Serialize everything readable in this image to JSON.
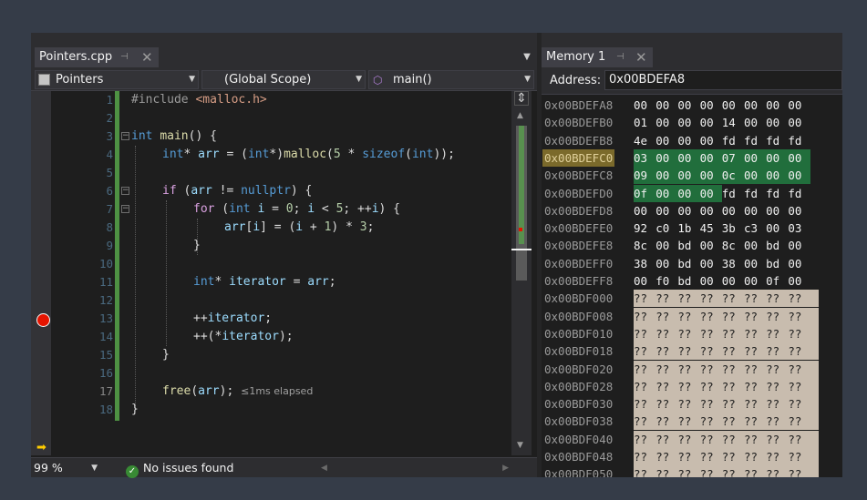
{
  "editor": {
    "tab_label": "Pointers.cpp",
    "pin_glyph": "⊣",
    "close_glyph": "✕",
    "dropdown_glyph": "▼",
    "nav": {
      "project": "Pointers",
      "scope": "(Global Scope)",
      "member": "main()"
    },
    "line_numbers": [
      "1",
      "2",
      "3",
      "4",
      "5",
      "6",
      "7",
      "8",
      "9",
      "10",
      "11",
      "12",
      "13",
      "14",
      "15",
      "16",
      "17",
      "18"
    ],
    "breakpoint_line": "13",
    "current_line": "17",
    "status": {
      "zoom": "99 %",
      "issues": "No issues found"
    }
  },
  "code": {
    "l1_directive": "#include",
    "l1_header": "<malloc.h>",
    "l3_kw": "int",
    "l3_fn": "main",
    "l3_rest": "() {",
    "l4_type": "int",
    "l4_a": "* ",
    "l4_var": "arr",
    "l4_b": " = (",
    "l4_type2": "int",
    "l4_c": "*)",
    "l4_fn": "malloc",
    "l4_d": "(",
    "l4_num": "5",
    "l4_e": " * ",
    "l4_kw": "sizeof",
    "l4_f": "(",
    "l4_type3": "int",
    "l4_g": "));",
    "l6_kw": "if",
    "l6_a": " (",
    "l6_var": "arr",
    "l6_b": " != ",
    "l6_kw2": "nullptr",
    "l6_c": ") {",
    "l7_kw": "for",
    "l7_a": " (",
    "l7_type": "int",
    "l7_b": " ",
    "l7_var": "i",
    "l7_c": " = ",
    "l7_num": "0",
    "l7_d": "; ",
    "l7_var2": "i",
    "l7_e": " < ",
    "l7_num2": "5",
    "l7_f": "; ++",
    "l7_var3": "i",
    "l7_g": ") {",
    "l8_var": "arr",
    "l8_a": "[",
    "l8_var2": "i",
    "l8_b": "] = (",
    "l8_var3": "i",
    "l8_c": " + ",
    "l8_num": "1",
    "l8_d": ") * ",
    "l8_num2": "3",
    "l8_e": ";",
    "l9": "}",
    "l11_type": "int",
    "l11_a": "* ",
    "l11_var": "iterator",
    "l11_b": " = ",
    "l11_var2": "arr",
    "l11_c": ";",
    "l13_a": "++",
    "l13_var": "iterator",
    "l13_b": ";",
    "l14_a": "++(*",
    "l14_var": "iterator",
    "l14_b": ");",
    "l15": "}",
    "l17_fn": "free",
    "l17_a": "(",
    "l17_var": "arr",
    "l17_b": ");",
    "l17_hint": "≤1ms elapsed",
    "l18": "}"
  },
  "memory": {
    "tab_label": "Memory 1",
    "address_label": "Address:",
    "address_value": "0x00BDEFA8",
    "rows": [
      {
        "addr": "0x00BDEFA8",
        "bytes": [
          "00",
          "00",
          "00",
          "00",
          "00",
          "00",
          "00",
          "00"
        ]
      },
      {
        "addr": "0x00BDEFB0",
        "bytes": [
          "01",
          "00",
          "00",
          "00",
          "14",
          "00",
          "00",
          "00"
        ]
      },
      {
        "addr": "0x00BDEFB8",
        "bytes": [
          "4e",
          "00",
          "00",
          "00",
          "fd",
          "fd",
          "fd",
          "fd"
        ]
      },
      {
        "addr": "0x00BDEFC0",
        "bytes": [
          "03",
          "00",
          "00",
          "00",
          "07",
          "00",
          "00",
          "00"
        ]
      },
      {
        "addr": "0x00BDEFC8",
        "bytes": [
          "09",
          "00",
          "00",
          "00",
          "0c",
          "00",
          "00",
          "00"
        ]
      },
      {
        "addr": "0x00BDEFD0",
        "bytes": [
          "0f",
          "00",
          "00",
          "00",
          "fd",
          "fd",
          "fd",
          "fd"
        ]
      },
      {
        "addr": "0x00BDEFD8",
        "bytes": [
          "00",
          "00",
          "00",
          "00",
          "00",
          "00",
          "00",
          "00"
        ]
      },
      {
        "addr": "0x00BDEFE0",
        "bytes": [
          "92",
          "c0",
          "1b",
          "45",
          "3b",
          "c3",
          "00",
          "03"
        ]
      },
      {
        "addr": "0x00BDEFE8",
        "bytes": [
          "8c",
          "00",
          "bd",
          "00",
          "8c",
          "00",
          "bd",
          "00"
        ]
      },
      {
        "addr": "0x00BDEFF0",
        "bytes": [
          "38",
          "00",
          "bd",
          "00",
          "38",
          "00",
          "bd",
          "00"
        ]
      },
      {
        "addr": "0x00BDEFF8",
        "bytes": [
          "00",
          "f0",
          "bd",
          "00",
          "00",
          "00",
          "0f",
          "00"
        ]
      },
      {
        "addr": "0x00BDF000",
        "bytes": [
          "??",
          "??",
          "??",
          "??",
          "??",
          "??",
          "??",
          "??"
        ]
      },
      {
        "addr": "0x00BDF008",
        "bytes": [
          "??",
          "??",
          "??",
          "??",
          "??",
          "??",
          "??",
          "??"
        ]
      },
      {
        "addr": "0x00BDF010",
        "bytes": [
          "??",
          "??",
          "??",
          "??",
          "??",
          "??",
          "??",
          "??"
        ]
      },
      {
        "addr": "0x00BDF018",
        "bytes": [
          "??",
          "??",
          "??",
          "??",
          "??",
          "??",
          "??",
          "??"
        ]
      },
      {
        "addr": "0x00BDF020",
        "bytes": [
          "??",
          "??",
          "??",
          "??",
          "??",
          "??",
          "??",
          "??"
        ]
      },
      {
        "addr": "0x00BDF028",
        "bytes": [
          "??",
          "??",
          "??",
          "??",
          "??",
          "??",
          "??",
          "??"
        ]
      },
      {
        "addr": "0x00BDF030",
        "bytes": [
          "??",
          "??",
          "??",
          "??",
          "??",
          "??",
          "??",
          "??"
        ]
      },
      {
        "addr": "0x00BDF038",
        "bytes": [
          "??",
          "??",
          "??",
          "??",
          "??",
          "??",
          "??",
          "??"
        ]
      },
      {
        "addr": "0x00BDF040",
        "bytes": [
          "??",
          "??",
          "??",
          "??",
          "??",
          "??",
          "??",
          "??"
        ]
      },
      {
        "addr": "0x00BDF048",
        "bytes": [
          "??",
          "??",
          "??",
          "??",
          "??",
          "??",
          "??",
          "??"
        ]
      },
      {
        "addr": "0x00BDF050",
        "bytes": [
          "??",
          "??",
          "??",
          "??",
          "??",
          "??",
          "??",
          "??"
        ]
      }
    ],
    "highlight_row": "0x00BDEFC0",
    "changed_bytes": {
      "0x00BDEFC0": [
        0,
        1,
        2,
        3,
        4,
        5,
        6,
        7
      ],
      "0x00BDEFC8": [
        0,
        1,
        2,
        3,
        4,
        5,
        6,
        7
      ],
      "0x00BDEFD0": [
        0,
        1,
        2,
        3
      ]
    }
  },
  "colors": {
    "background": "#353c48",
    "editor_bg": "#1e1e1e",
    "keyword": "#569cd6",
    "string_header": "#d69d85",
    "function": "#dcdcaa",
    "number": "#b5cea8",
    "variable": "#9cdcfe",
    "breakpoint": "#e51400",
    "changed_memory": "#216e3c",
    "unknown_memory": "#c8bcae"
  }
}
